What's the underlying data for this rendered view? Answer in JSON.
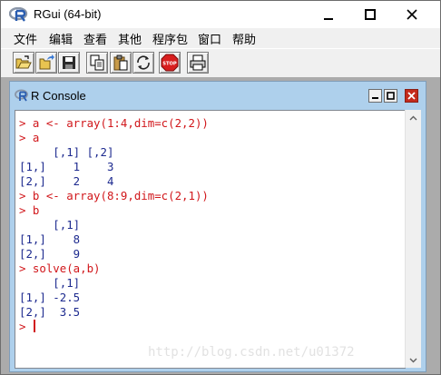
{
  "window": {
    "title": "RGui (64-bit)",
    "controls": {
      "minimize": "—",
      "maximize": "☐",
      "close": "✕"
    }
  },
  "menu": {
    "items": [
      "文件",
      "编辑",
      "查看",
      "其他",
      "程序包",
      "窗口",
      "帮助"
    ]
  },
  "toolbar": {
    "buttons": [
      "open-script-icon",
      "load-workspace-icon",
      "save-icon",
      "copy-icon",
      "paste-icon",
      "copy-paste-icon",
      "stop-icon",
      "print-icon"
    ],
    "stop_label": "STOP"
  },
  "console": {
    "title": "R Console",
    "lines": [
      {
        "kind": "input",
        "text": "> a <- array(1:4,dim=c(2,2))"
      },
      {
        "kind": "input",
        "text": "> a"
      },
      {
        "kind": "output",
        "text": "     [,1] [,2]"
      },
      {
        "kind": "output",
        "text": "[1,]    1    3"
      },
      {
        "kind": "output",
        "text": "[2,]    2    4"
      },
      {
        "kind": "input",
        "text": "> b <- array(8:9,dim=c(2,1))"
      },
      {
        "kind": "input",
        "text": "> b"
      },
      {
        "kind": "output",
        "text": "     [,1]"
      },
      {
        "kind": "output",
        "text": "[1,]    8"
      },
      {
        "kind": "output",
        "text": "[2,]    9"
      },
      {
        "kind": "input",
        "text": "> solve(a,b)"
      },
      {
        "kind": "output",
        "text": "     [,1]"
      },
      {
        "kind": "output",
        "text": "[1,] -2.5"
      },
      {
        "kind": "output",
        "text": "[2,]  3.5"
      }
    ],
    "prompt": "> ",
    "watermark": "http://blog.csdn.net/u01372"
  },
  "colors": {
    "input_text": "#d1171b",
    "output_text": "#1d2a8f",
    "child_frame": "#aed0ec",
    "mdi_background": "#ababab",
    "close_button": "#c42b1c"
  }
}
